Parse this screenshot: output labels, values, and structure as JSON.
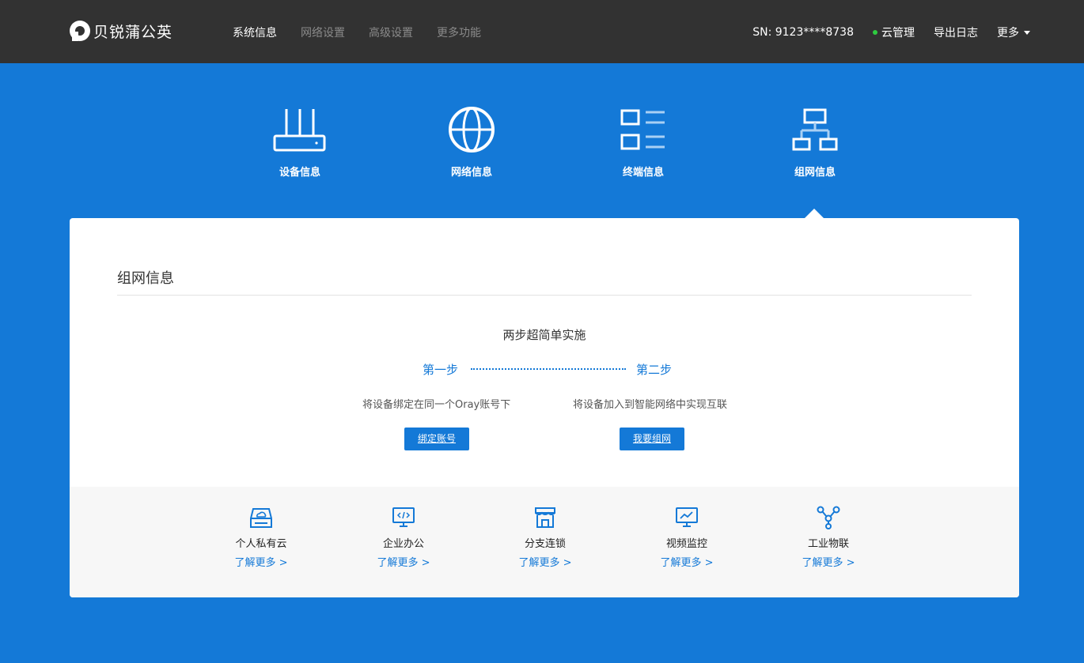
{
  "header": {
    "brand": "贝锐蒲公英",
    "nav": [
      {
        "label": "系统信息",
        "active": true
      },
      {
        "label": "网络设置",
        "active": false
      },
      {
        "label": "高级设置",
        "active": false
      },
      {
        "label": "更多功能",
        "active": false
      }
    ],
    "sn": "SN:  9123****8738",
    "cloud_label": "云管理",
    "cloud_status_color": "#2ecc40",
    "export_label": "导出日志",
    "more_label": "更多"
  },
  "categories": [
    {
      "label": "设备信息",
      "icon": "router-icon"
    },
    {
      "label": "网络信息",
      "icon": "globe-icon"
    },
    {
      "label": "终端信息",
      "icon": "terminal-list-icon"
    },
    {
      "label": "组网信息",
      "icon": "network-topology-icon",
      "selected": true
    }
  ],
  "panel": {
    "title": "组网信息",
    "steps_title": "两步超简单实施",
    "step1": {
      "label": "第一步",
      "desc": "将设备绑定在同一个Oray账号下",
      "button": "绑定账号"
    },
    "step2": {
      "label": "第二步",
      "desc": "将设备加入到智能网络中实现互联",
      "button": "我要组网"
    }
  },
  "features": [
    {
      "name": "个人私有云",
      "link": "了解更多 >",
      "icon": "private-cloud-icon"
    },
    {
      "name": "企业办公",
      "link": "了解更多 >",
      "icon": "office-monitor-icon"
    },
    {
      "name": "分支连锁",
      "link": "了解更多 >",
      "icon": "store-icon"
    },
    {
      "name": "视频监控",
      "link": "了解更多 >",
      "icon": "video-monitor-icon"
    },
    {
      "name": "工业物联",
      "link": "了解更多 >",
      "icon": "iot-icon"
    }
  ],
  "colors": {
    "accent": "#1479d7",
    "topbar": "#323232",
    "background": "#1479d7"
  }
}
